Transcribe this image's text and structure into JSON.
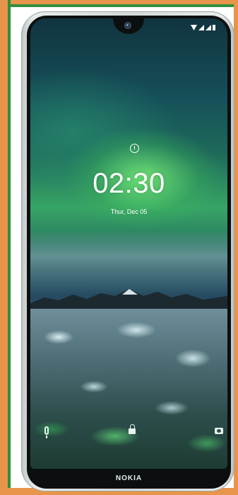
{
  "status_bar": {
    "icons": [
      "wifi-icon",
      "signal-icon",
      "signal-icon",
      "battery-icon"
    ]
  },
  "lock_screen": {
    "alarm_icon": "alarm-icon",
    "time": "02:30",
    "date": "Thur, Dec 05"
  },
  "shortcuts": {
    "left_icon": "mic-icon",
    "center_icon": "lock-icon",
    "right_icon": "camera-icon"
  },
  "device": {
    "brand": "NOKIA"
  },
  "colors": {
    "frame_orange": "#e8944a",
    "frame_green": "#2f8f3a",
    "text": "#ffffff"
  }
}
